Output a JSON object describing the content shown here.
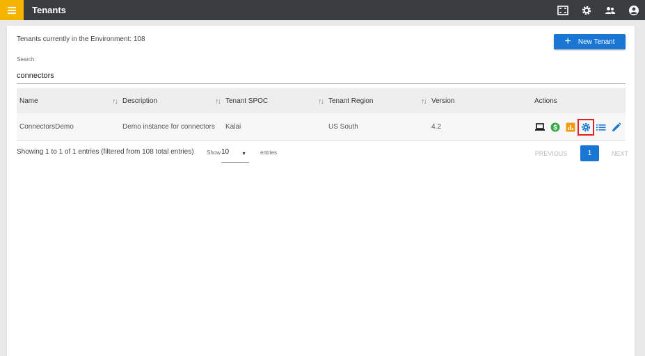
{
  "header": {
    "title": "Tenants",
    "menu_icon": "hamburger-menu-icon",
    "icons": [
      "fullscreen-icon",
      "settings-gear-icon",
      "users-icon",
      "account-circle-icon"
    ]
  },
  "summary": {
    "env_count_text": "Tenants currently in the Environment: 108",
    "new_tenant_label": "New Tenant"
  },
  "search": {
    "label": "Search:",
    "value": "connectors"
  },
  "table": {
    "columns": [
      "Name",
      "Description",
      "Tenant SPOC",
      "Tenant Region",
      "Version",
      "Actions"
    ],
    "rows": [
      {
        "name": "ConnectorsDemo",
        "description": "Demo instance for connectors",
        "spoc": "Kalai",
        "region": "US South",
        "version": "4.2",
        "actions": [
          "laptop-icon",
          "dollar-icon",
          "chart-icon",
          "settings-gear-icon",
          "list-icon",
          "edit-pencil-icon"
        ]
      }
    ]
  },
  "footer": {
    "info": "Showing 1 to 1 of 1 entries (filtered from 108 total entries)",
    "show_label": "Show",
    "page_size": "10",
    "entries_label": "entries"
  },
  "pagination": {
    "previous": "PREVIOUS",
    "current_page": "1",
    "next": "NEXT"
  },
  "colors": {
    "topbar": "#3a3d40",
    "menu_accent": "#f5b400",
    "primary": "#1976d2",
    "highlight_box": "#e02020"
  }
}
